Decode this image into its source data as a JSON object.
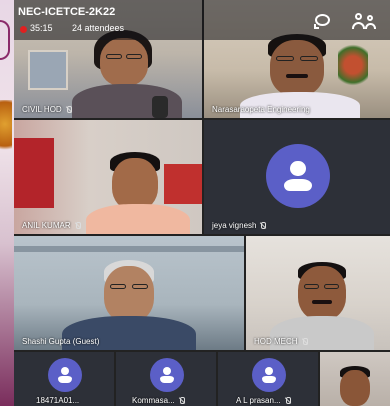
{
  "meeting": {
    "title": "NEC-ICETCE-2K22",
    "timer": "35:15",
    "attendees": "24 attendees"
  },
  "tiles": [
    {
      "label": "CIVIL HOD"
    },
    {
      "label": "Narasaraopeta Engineering"
    },
    {
      "label": "ANIL KUMAR"
    },
    {
      "label": "jeya vignesh"
    },
    {
      "label": "Shashi Gupta (Guest)"
    },
    {
      "label": "HOD MECH"
    },
    {
      "label": "18471A01..."
    },
    {
      "label": "Kommasa..."
    },
    {
      "label": "A L prasan..."
    }
  ],
  "colors": {
    "avatar": "#5b5fc7",
    "recording": "#e02020"
  },
  "icons": [
    "chat-icon",
    "people-icon",
    "mic-off-icon",
    "person-avatar-icon"
  ]
}
